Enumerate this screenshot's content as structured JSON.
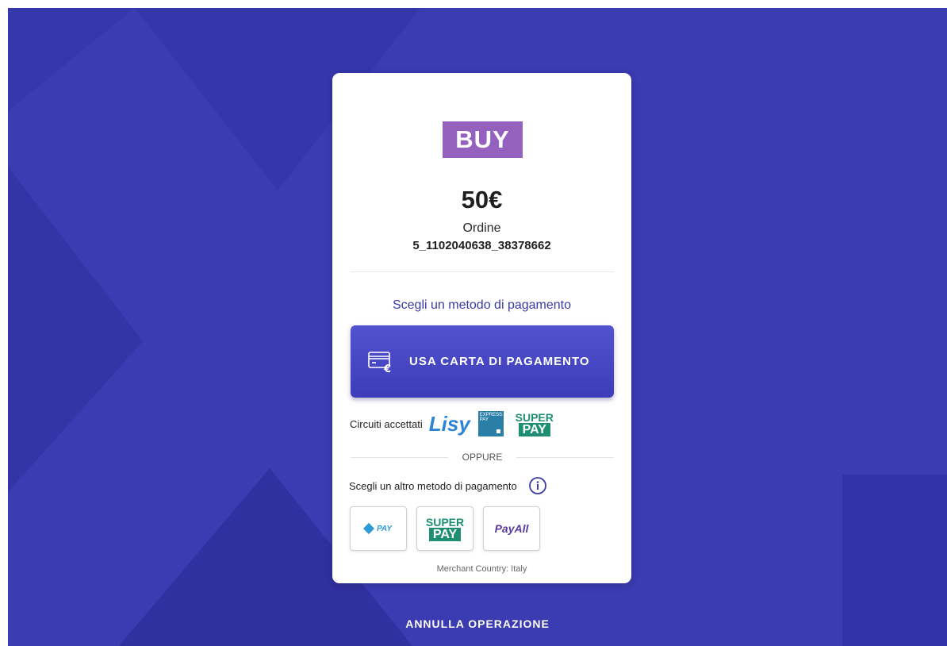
{
  "colors": {
    "background": "#3a3ab0",
    "accent": "#4545c4",
    "logo_bg": "#9461bf",
    "superpay_green": "#1f8f73"
  },
  "merchant_logo": {
    "text": "BUY"
  },
  "order": {
    "amount": "50€",
    "label": "Ordine",
    "number": "5_1102040638_38378662"
  },
  "payment": {
    "title": "Scegli un metodo di pagamento",
    "card_button": {
      "label": "USA CARTA DI PAGAMENTO",
      "icon": "credit-card-euro-icon"
    },
    "circuits_label": "Circuiti accettati",
    "circuits": [
      {
        "name": "lisy",
        "text": "Lisy"
      },
      {
        "name": "express-pay",
        "text": "EXPRESS PAY"
      },
      {
        "name": "superpay",
        "top": "SUPER",
        "bottom": "PAY"
      }
    ]
  },
  "separator": {
    "text": "OPPURE"
  },
  "alternatives": {
    "label": "Scegli un altro metodo di pagamento",
    "info_icon": "info-icon",
    "methods": [
      {
        "name": "epay",
        "text": "PAY"
      },
      {
        "name": "superpay",
        "top": "SUPER",
        "bottom": "PAY"
      },
      {
        "name": "payall",
        "text": "PayAll"
      }
    ]
  },
  "merchant_country": "Merchant Country: Italy",
  "cancel_label": "ANNULLA OPERAZIONE"
}
